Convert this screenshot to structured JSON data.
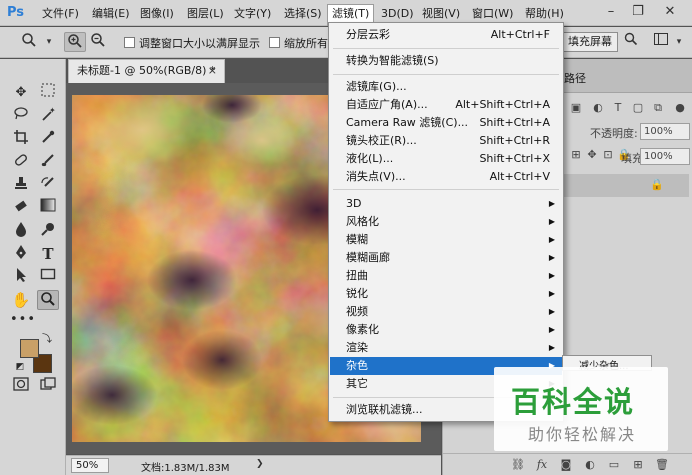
{
  "app": {
    "logo": "Ps"
  },
  "menu": {
    "items": [
      "文件(F)",
      "编辑(E)",
      "图像(I)",
      "图层(L)",
      "文字(Y)",
      "选择(S)",
      "滤镜(T)",
      "3D(D)",
      "视图(V)",
      "窗口(W)",
      "帮助(H)"
    ],
    "active": "滤镜(T)"
  },
  "window_controls": {
    "minimize": "–",
    "restore": "❐",
    "close": "✕"
  },
  "options": {
    "resize_windows_label": "调整窗口大小以满屏显示",
    "zoom_all_label": "缩放所有",
    "fill_screen_label": "填充屏幕"
  },
  "document": {
    "tab_title": "未标题-1 @ 50%(RGB/8) *",
    "tab_close": "×",
    "zoom": "50%",
    "doc_info": "文档:1.83M/1.83M"
  },
  "panel": {
    "paths_tab": "路径",
    "opacity_label": "不透明度:",
    "opacity_value": "100%",
    "fill_label": "填充:",
    "fill_value": "100%"
  },
  "filter_menu": {
    "items": [
      {
        "label": "分层云彩",
        "shortcut": "Alt+Ctrl+F"
      },
      {
        "label": "转换为智能滤镜(S)"
      },
      {
        "label": "滤镜库(G)..."
      },
      {
        "label": "自适应广角(A)...",
        "shortcut": "Alt+Shift+Ctrl+A"
      },
      {
        "label": "Camera Raw 滤镜(C)...",
        "shortcut": "Shift+Ctrl+A"
      },
      {
        "label": "镜头校正(R)...",
        "shortcut": "Shift+Ctrl+R"
      },
      {
        "label": "液化(L)...",
        "shortcut": "Shift+Ctrl+X"
      },
      {
        "label": "消失点(V)...",
        "shortcut": "Alt+Ctrl+V"
      },
      {
        "label": "3D",
        "submenu": true
      },
      {
        "label": "风格化",
        "submenu": true
      },
      {
        "label": "模糊",
        "submenu": true
      },
      {
        "label": "模糊画廊",
        "submenu": true
      },
      {
        "label": "扭曲",
        "submenu": true
      },
      {
        "label": "锐化",
        "submenu": true
      },
      {
        "label": "视频",
        "submenu": true
      },
      {
        "label": "像素化",
        "submenu": true
      },
      {
        "label": "渲染",
        "submenu": true
      },
      {
        "label": "杂色",
        "submenu": true,
        "highlighted": true
      },
      {
        "label": "其它",
        "submenu": true
      },
      {
        "label": "浏览联机滤镜..."
      }
    ],
    "submenu_arrow": "▶"
  },
  "noise_submenu": {
    "first_item": "减少杂色..."
  },
  "watermark": {
    "title": "百科全说",
    "subtitle": "助你轻松解决"
  },
  "colors": {
    "menu_highlight": "#1f72c9",
    "foreground": "#c9a067",
    "background": "#5a3510",
    "watermark_green": "#2c9e3a"
  }
}
